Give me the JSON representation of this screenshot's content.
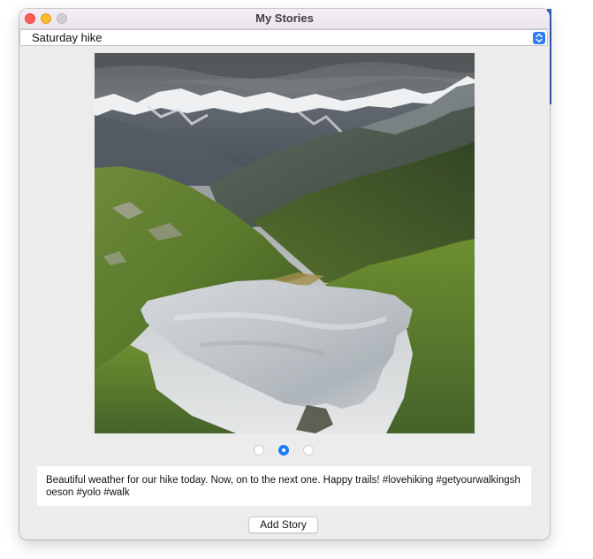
{
  "window": {
    "title": "My Stories",
    "controls": [
      "close",
      "minimize",
      "maximize"
    ]
  },
  "story_selector": {
    "selected": "Saturday hike",
    "icon": "chevron-up-down-icon",
    "accent_color": "#2f7cf6"
  },
  "photo": {
    "subject": "heart-shaped alpine lake with green hills and snow-capped mountains"
  },
  "pager": {
    "count": 3,
    "active_index": 1,
    "accent_color": "#1f7af5"
  },
  "story": {
    "caption": "Beautiful weather for our hike today. Now, on to the next one. Happy trails! #lovehiking #getyourwalkingshoeson #yolo #walk"
  },
  "actions": {
    "add_story_label": "Add Story"
  }
}
